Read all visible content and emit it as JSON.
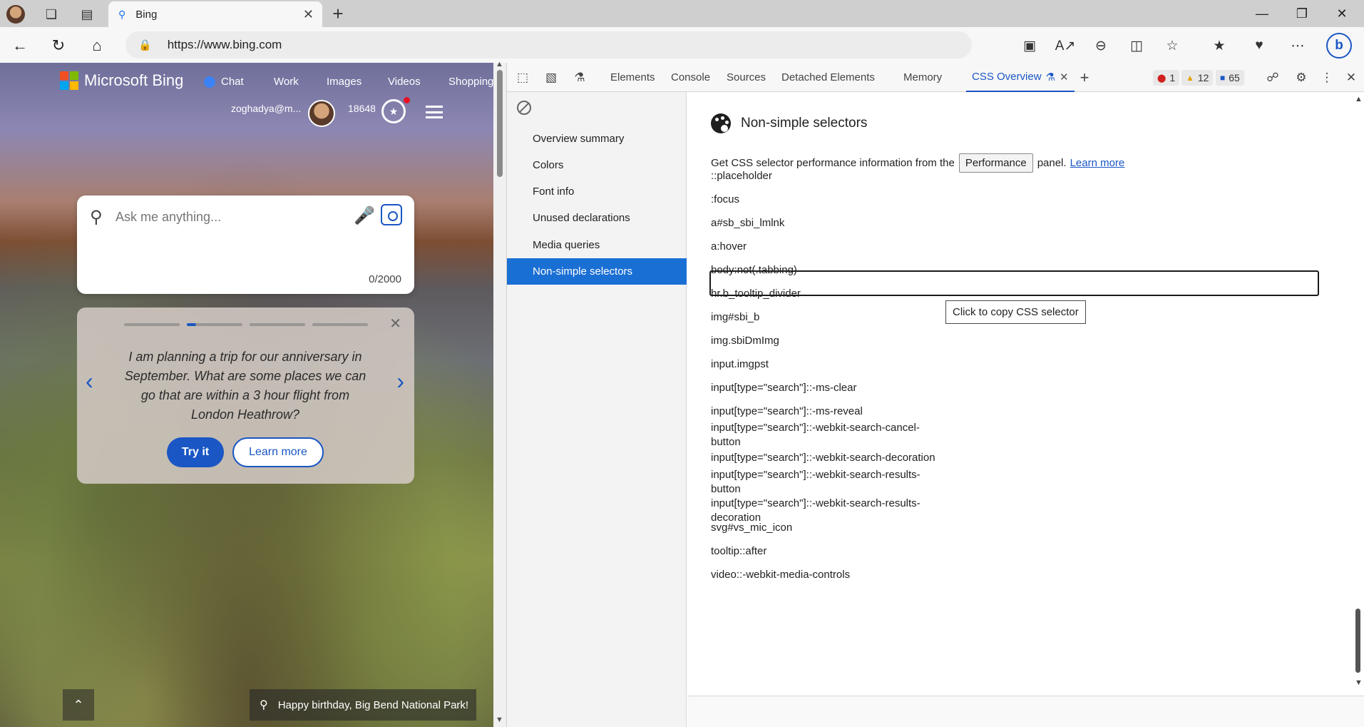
{
  "browser": {
    "tab": {
      "title": "Bing",
      "favicon": "search-icon"
    },
    "url": "https://www.bing.com"
  },
  "bing": {
    "brand": "Microsoft Bing",
    "nav": [
      "Chat",
      "Work",
      "Images",
      "Videos",
      "Shopping"
    ],
    "user_name": "zoghadya@m...",
    "reward_points": "18648",
    "search": {
      "placeholder": "Ask me anything...",
      "char_count": "0/2000"
    },
    "suggestion": {
      "text": "I am planning a trip for our anniversary in September. What are some places we can go that are within a 3 hour flight from London Heathrow?",
      "try_label": "Try it",
      "learn_label": "Learn more",
      "dots_total": 4,
      "dots_active": 2
    },
    "caption": "Happy birthday, Big Bend National Park!"
  },
  "devtools": {
    "tabs": [
      "Elements",
      "Console",
      "Sources",
      "Detached Elements",
      "Memory",
      "CSS Overview"
    ],
    "active_tab": "CSS Overview",
    "badges": {
      "errors": "1",
      "warnings": "12",
      "info": "65"
    },
    "sidebar": {
      "items": [
        "Overview summary",
        "Colors",
        "Font info",
        "Unused declarations",
        "Media queries",
        "Non-simple selectors"
      ],
      "active": "Non-simple selectors"
    },
    "main": {
      "title": "Non-simple selectors",
      "info_prefix": "Get CSS selector performance information from the",
      "performance_button": "Performance",
      "info_suffix": "panel.",
      "learn_more": "Learn more",
      "selectors": [
        "::placeholder",
        ":focus",
        "a#sb_sbi_lmlnk",
        "a:hover",
        "body:not(.tabbing)",
        "hr.b_tooltip_divider",
        "img#sbi_b",
        "img.sbiDmImg",
        "input.imgpst",
        "input[type=\"search\"]::-ms-clear",
        "input[type=\"search\"]::-ms-reveal",
        "input[type=\"search\"]::-webkit-search-cancel-\nbutton",
        "input[type=\"search\"]::-webkit-search-decoration",
        "input[type=\"search\"]::-webkit-search-results-\nbutton",
        "input[type=\"search\"]::-webkit-search-results-\ndecoration",
        "svg#vs_mic_icon",
        "tooltip::after",
        "video::-webkit-media-controls"
      ],
      "tooltip": "Click to copy CSS selector"
    }
  }
}
